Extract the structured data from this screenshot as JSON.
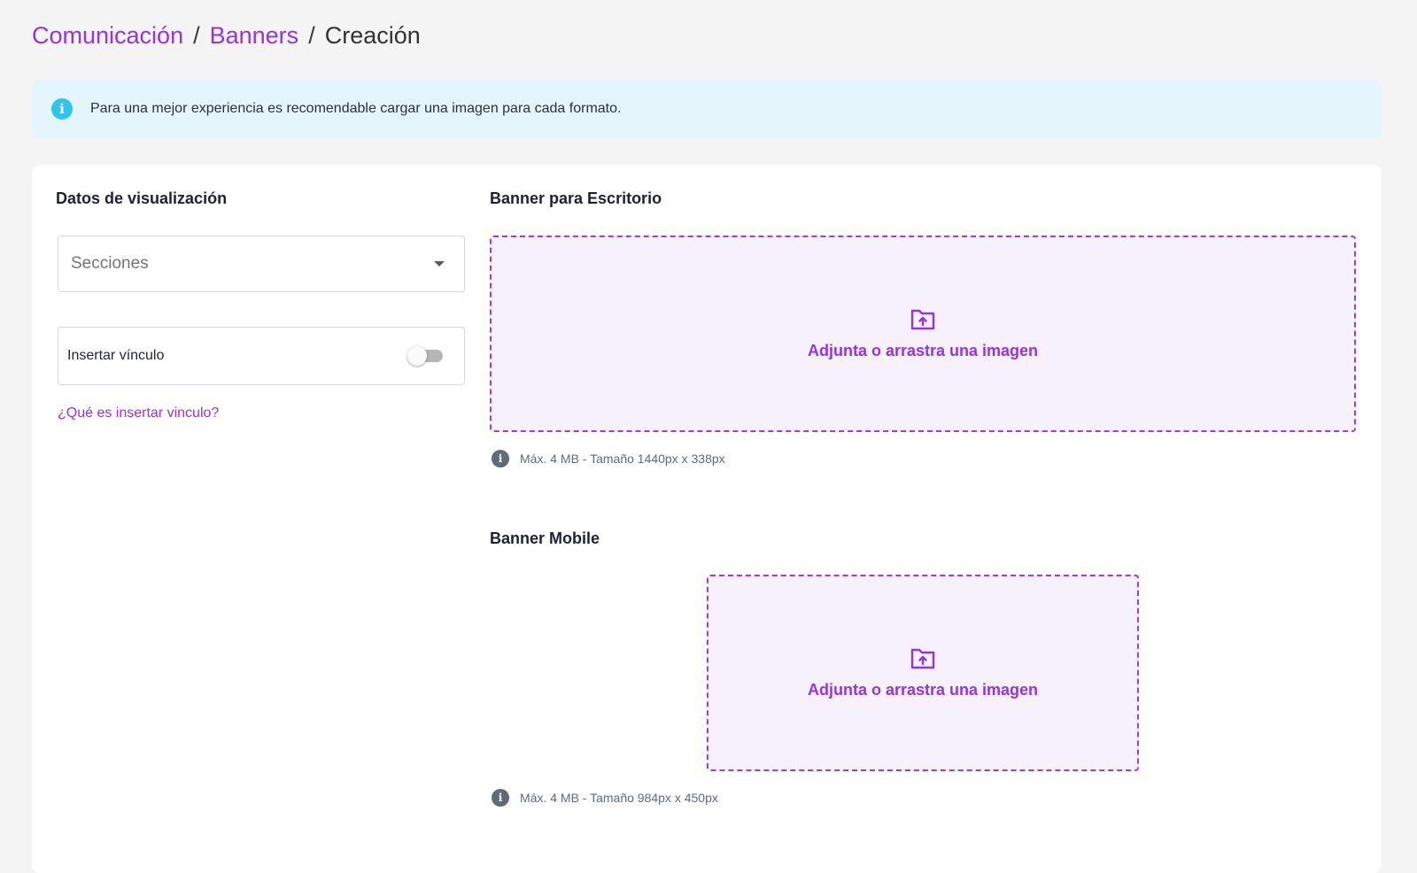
{
  "breadcrumb": {
    "items": [
      "Comunicación",
      "Banners",
      "Creación"
    ],
    "separator": "/"
  },
  "alert": {
    "icon": "info-icon",
    "text": "Para una mejor experiencia es recomendable cargar una imagen para cada formato."
  },
  "display_data": {
    "title": "Datos de visualización",
    "sections_placeholder": "Secciones",
    "insert_link_label": "Insertar vínculo",
    "insert_link_enabled": false,
    "help_link": "¿Qué es insertar vinculo?"
  },
  "desktop_banner": {
    "title": "Banner para Escritorio",
    "drop_text": "Adjunta o arrastra una imagen",
    "hint": "Máx. 4 MB - Tamaño 1440px x 338px"
  },
  "mobile_banner": {
    "title": "Banner Mobile",
    "drop_text": "Adjunta o arrastra una imagen",
    "hint": "Máx. 4 MB - Tamaño 984px x 450px"
  },
  "colors": {
    "accent": "#9333ea",
    "info": "#2ec4ec",
    "alert_bg": "#e4f6fb"
  }
}
